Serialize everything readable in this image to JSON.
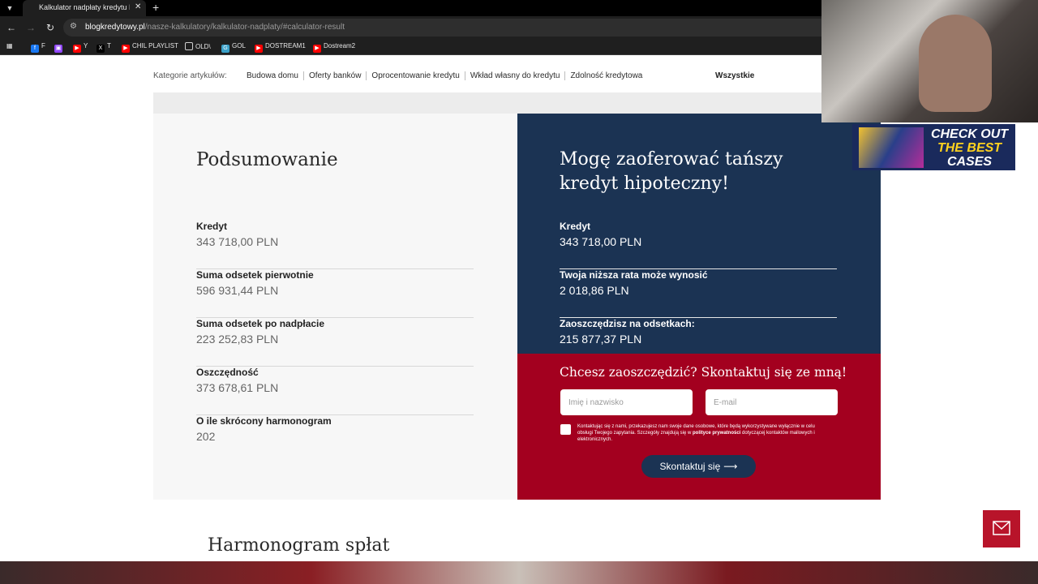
{
  "browser": {
    "tab_title": "Kalkulator nadpłaty kredytu hip",
    "url_host": "blogkredytowy.pl",
    "url_path": "/nasze-kalkulatory/kalkulator-nadplaty/#calculator-result",
    "bookmarks": [
      {
        "label": "F",
        "icon": "facebook-icon",
        "color": "#1877f2"
      },
      {
        "label": "",
        "icon": "twitch-icon",
        "color": "#9146ff"
      },
      {
        "label": "Y",
        "icon": "youtube-icon",
        "color": "#ff0000"
      },
      {
        "label": "T",
        "icon": "x-icon",
        "color": "#000000"
      },
      {
        "label": "CHIL PLAYLIST",
        "icon": "youtube-icon",
        "color": "#ff0000"
      },
      {
        "label": "OLD\\",
        "icon": "folder-icon",
        "color": "#1f1f1f"
      },
      {
        "label": "GOL",
        "icon": "gol-icon",
        "color": "#3aa0c8"
      },
      {
        "label": "DOSTREAM1",
        "icon": "youtube-icon",
        "color": "#ff0000"
      },
      {
        "label": "Dostream2",
        "icon": "youtube-icon",
        "color": "#ff0000"
      }
    ]
  },
  "categories": {
    "label": "Kategorie artykułów:",
    "links": [
      "Budowa domu",
      "Oferty banków",
      "Oprocentowanie kredytu",
      "Wkład własny do kredytu",
      "Zdolność kredytowa"
    ],
    "all_label": "Wszystkie"
  },
  "summary": {
    "title": "Podsumowanie",
    "rows": [
      {
        "label": "Kredyt",
        "value": "343 718,00 PLN"
      },
      {
        "label": "Suma odsetek pierwotnie",
        "value": "596 931,44 PLN"
      },
      {
        "label": "Suma odsetek po nadpłacie",
        "value": "223 252,83 PLN"
      },
      {
        "label": "Oszczędność",
        "value": "373 678,61 PLN"
      },
      {
        "label": "O ile skrócony harmonogram",
        "value": "202"
      }
    ]
  },
  "offer": {
    "title": "Mogę zaoferować tańszy kredyt hipoteczny!",
    "rows": [
      {
        "label": "Kredyt",
        "value": "343 718,00 PLN"
      },
      {
        "label": "Twoja niższa rata może wynosić",
        "value": "2 018,86 PLN"
      },
      {
        "label": "Zaoszczędzisz na odsetkach:",
        "value": "215 877,37 PLN"
      }
    ],
    "colors": {
      "navy": "#1b3353",
      "red": "#a3001f"
    }
  },
  "contact": {
    "title": "Chcesz zaoszczędzić? Skontaktuj się ze mną!",
    "name_placeholder": "Imię i nazwisko",
    "email_placeholder": "E-mail",
    "consent_text": "Kontaktując się z nami, przekazujesz nam swoje dane osobowe, które będą wykorzystywane wyłącznie w celu obsługi Twojego zapytania. Szczegóły znajdują się w",
    "consent_link": "polityce prywatności",
    "consent_tail": "dotyczącej kontaktów mailowych i elektronicznych.",
    "button_label": "Skontaktuj się"
  },
  "schedule": {
    "title": "Harmonogram spłat"
  },
  "ad": {
    "line1": "CHECK OUT",
    "line2": "THE BEST",
    "line3": "CASES"
  }
}
